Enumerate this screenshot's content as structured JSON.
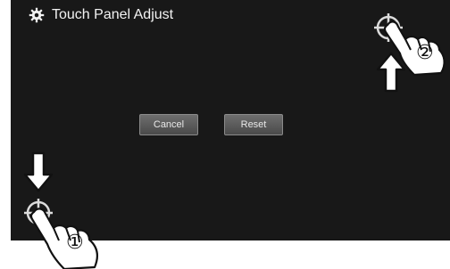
{
  "header": {
    "title": "Touch Panel Adjust",
    "icon": "gear-icon"
  },
  "buttons": {
    "cancel_label": "Cancel",
    "reset_label": "Reset"
  },
  "steps": {
    "step1_label": "①",
    "step2_label": "②"
  },
  "colors": {
    "screen_bg": "#181818",
    "text": "#f2f2f2",
    "button_bg": "#5a5a5a",
    "page_bg": "#ffffff"
  }
}
